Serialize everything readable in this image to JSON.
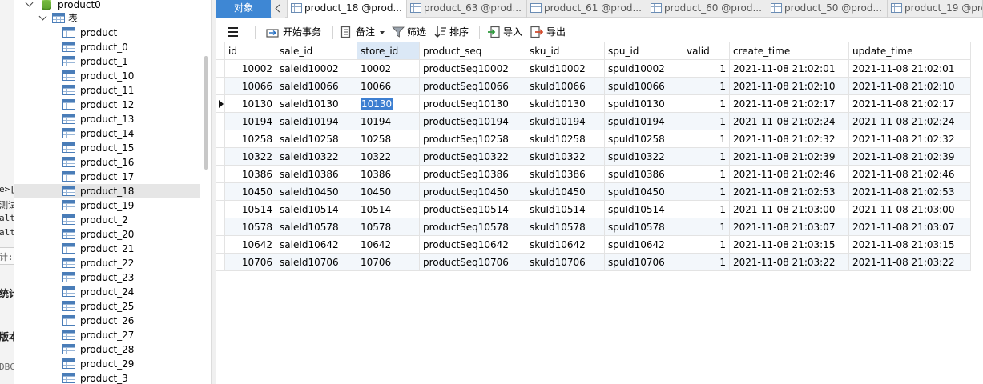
{
  "left_fragments": [
    "e>[",
    "测试",
    "alt",
    "alt",
    "计:",
    "统计",
    "版本",
    "DBC"
  ],
  "tree": {
    "db_name": "product0",
    "group_label": "表",
    "tables": [
      "product",
      "product_0",
      "product_1",
      "product_10",
      "product_11",
      "product_12",
      "product_13",
      "product_14",
      "product_15",
      "product_16",
      "product_17",
      "product_18",
      "product_19",
      "product_2",
      "product_20",
      "product_21",
      "product_22",
      "product_23",
      "product_24",
      "product_25",
      "product_26",
      "product_27",
      "product_28",
      "product_29",
      "product_3"
    ],
    "selected": "product_18"
  },
  "tabs": {
    "objects_label": "对象",
    "items": [
      "product_18 @prod...",
      "product_63 @prod...",
      "product_61 @prod...",
      "product_60 @prod...",
      "product_50 @prod...",
      "product_19 @prod"
    ],
    "active_index": 0
  },
  "toolbar": {
    "begin_tx": "开始事务",
    "note": "备注",
    "filter": "筛选",
    "sort": "排序",
    "import": "导入",
    "export": "导出"
  },
  "grid": {
    "columns": [
      "id",
      "sale_id",
      "store_id",
      "product_seq",
      "sku_id",
      "spu_id",
      "valid",
      "create_time",
      "update_time"
    ],
    "highlighted_column": "store_id",
    "current_row_index": 2,
    "selected_cell": "10130",
    "rows": [
      [
        "10002",
        "saleId10002",
        "10002",
        "productSeq10002",
        "skuId10002",
        "spuId10002",
        "1",
        "2021-11-08 21:02:01",
        "2021-11-08 21:02:01"
      ],
      [
        "10066",
        "saleId10066",
        "10066",
        "productSeq10066",
        "skuId10066",
        "spuId10066",
        "1",
        "2021-11-08 21:02:10",
        "2021-11-08 21:02:10"
      ],
      [
        "10130",
        "saleId10130",
        "10130",
        "productSeq10130",
        "skuId10130",
        "spuId10130",
        "1",
        "2021-11-08 21:02:17",
        "2021-11-08 21:02:17"
      ],
      [
        "10194",
        "saleId10194",
        "10194",
        "productSeq10194",
        "skuId10194",
        "spuId10194",
        "1",
        "2021-11-08 21:02:24",
        "2021-11-08 21:02:24"
      ],
      [
        "10258",
        "saleId10258",
        "10258",
        "productSeq10258",
        "skuId10258",
        "spuId10258",
        "1",
        "2021-11-08 21:02:32",
        "2021-11-08 21:02:32"
      ],
      [
        "10322",
        "saleId10322",
        "10322",
        "productSeq10322",
        "skuId10322",
        "spuId10322",
        "1",
        "2021-11-08 21:02:39",
        "2021-11-08 21:02:39"
      ],
      [
        "10386",
        "saleId10386",
        "10386",
        "productSeq10386",
        "skuId10386",
        "spuId10386",
        "1",
        "2021-11-08 21:02:46",
        "2021-11-08 21:02:46"
      ],
      [
        "10450",
        "saleId10450",
        "10450",
        "productSeq10450",
        "skuId10450",
        "spuId10450",
        "1",
        "2021-11-08 21:02:53",
        "2021-11-08 21:02:53"
      ],
      [
        "10514",
        "saleId10514",
        "10514",
        "productSeq10514",
        "skuId10514",
        "spuId10514",
        "1",
        "2021-11-08 21:03:00",
        "2021-11-08 21:03:00"
      ],
      [
        "10578",
        "saleId10578",
        "10578",
        "productSeq10578",
        "skuId10578",
        "spuId10578",
        "1",
        "2021-11-08 21:03:07",
        "2021-11-08 21:03:07"
      ],
      [
        "10642",
        "saleId10642",
        "10642",
        "productSeq10642",
        "skuId10642",
        "spuId10642",
        "1",
        "2021-11-08 21:03:15",
        "2021-11-08 21:03:15"
      ],
      [
        "10706",
        "saleId10706",
        "10706",
        "productSeq10706",
        "skuId10706",
        "spuId10706",
        "1",
        "2021-11-08 21:03:22",
        "2021-11-08 21:03:22"
      ]
    ]
  },
  "colors": {
    "accent": "#3e87d4",
    "selection": "#3d7fd1",
    "header_highlight": "#dbe8f6",
    "alt_row": "#f3f7fb"
  }
}
